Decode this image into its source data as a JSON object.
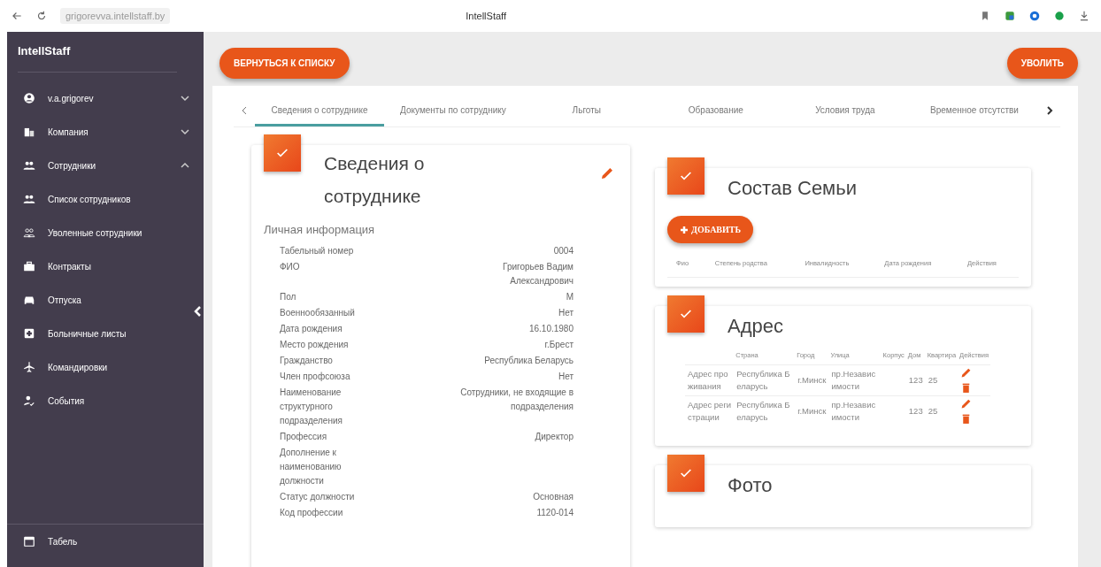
{
  "browser": {
    "url": "grigorevva.intellstaff.by",
    "title": "IntellStaff"
  },
  "sidebar": {
    "title": "IntellStaff",
    "items": [
      {
        "label": "v.a.grigorev",
        "expanded": false
      },
      {
        "label": "Компания",
        "expanded": false
      },
      {
        "label": "Сотрудники",
        "expanded": true,
        "children": [
          {
            "label": "Список сотрудников"
          },
          {
            "label": "Уволенные сотрудники"
          }
        ]
      },
      {
        "label": "Контракты"
      },
      {
        "label": "Отпуска"
      },
      {
        "label": "Больничные листы"
      },
      {
        "label": "Командировки"
      },
      {
        "label": "События"
      },
      {
        "label": "Табель"
      }
    ]
  },
  "toolbar": {
    "back_button": "ВЕРНУТЬСЯ К СПИСКУ",
    "dismiss_button": "УВОЛИТЬ"
  },
  "tabs": [
    {
      "label": "Сведения о сотруднике",
      "selected": true
    },
    {
      "label": "Документы по сотруднику",
      "selected": false
    },
    {
      "label": "Льготы",
      "selected": false
    },
    {
      "label": "Образование",
      "selected": false
    },
    {
      "label": "Условия труда",
      "selected": false
    },
    {
      "label": "Временное отсутстви",
      "selected": false
    }
  ],
  "employee_card": {
    "title": "Сведения о сотруднике",
    "section": "Личная информация",
    "fields": [
      {
        "label": "Табельный номер",
        "value": "0004"
      },
      {
        "label": "ФИО",
        "value": "Григорьев Вадим Александрович"
      },
      {
        "label": "Пол",
        "value": "М"
      },
      {
        "label": "Военнообязанный",
        "value": "Нет"
      },
      {
        "label": "Дата рождения",
        "value": "16.10.1980"
      },
      {
        "label": "Место рождения",
        "value": "г.Брест"
      },
      {
        "label": "Гражданство",
        "value": "Республика Беларусь"
      },
      {
        "label": "Член профсоюза",
        "value": "Нет"
      },
      {
        "label": "Наименование структурного подразделения",
        "value": "Сотрудники, не входящие в подразделения"
      },
      {
        "label": "Профессия",
        "value": "Директор"
      },
      {
        "label": "Дополнение к наименованию должности"
      },
      {
        "label": "Статус должности",
        "value": "Основная"
      },
      {
        "label": "Код профессии",
        "value": "1120-014"
      }
    ]
  },
  "family_card": {
    "title": "Состав Семьи",
    "add_button": "ДОБАВИТЬ",
    "columns": [
      "Фио",
      "Степень родства",
      "Инвалидность",
      "Дата рождения",
      "Действия"
    ]
  },
  "address_card": {
    "title": "Адрес",
    "columns": [
      "Страна",
      "Город",
      "Улица",
      "Корпус",
      "Дом",
      "Квартира",
      "Действия"
    ],
    "rows": [
      {
        "type": "Адрес проживания",
        "country": "Республика Беларусь",
        "city": "г.Минск",
        "street": "пр.Независимости",
        "house": "123",
        "apartment": "25"
      },
      {
        "type": "Адрес регистрации",
        "country": "Республика Беларусь",
        "city": "г.Минск",
        "street": "пр.Независимости",
        "house": "123",
        "apartment": "25"
      }
    ]
  },
  "photo_card": {
    "title": "Фото"
  }
}
